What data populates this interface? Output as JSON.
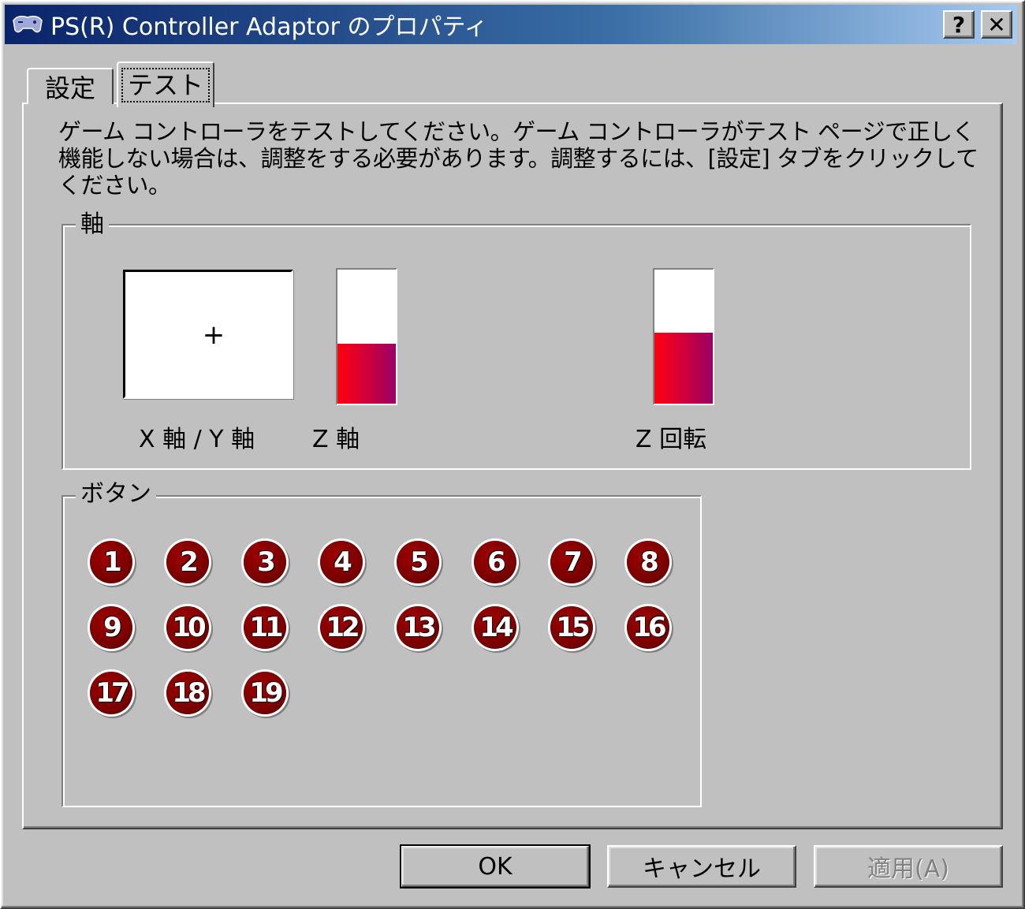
{
  "window": {
    "title": "PS(R) Controller Adaptor のプロパティ",
    "help_label": "?",
    "close_label": "✕"
  },
  "tabs": [
    {
      "label": "設定",
      "selected": false
    },
    {
      "label": "テスト",
      "selected": true
    }
  ],
  "description": "ゲーム コントローラをテストしてください。ゲーム コントローラがテスト ページで正しく機能しない場合は、調整をする必要があります。調整するには、[設定] タブをクリックしてください。",
  "axes": {
    "legend": "軸",
    "crosshair": "+",
    "xy_label": "X 軸 / Y 軸",
    "z_label": "Z 軸",
    "z_level": 0.45,
    "z_rotation_label": "Z 回転",
    "z_rotation_level": 0.53
  },
  "buttons_group": {
    "legend": "ボタン",
    "items": [
      "1",
      "2",
      "3",
      "4",
      "5",
      "6",
      "7",
      "8",
      "9",
      "10",
      "11",
      "12",
      "13",
      "14",
      "15",
      "16",
      "17",
      "18",
      "19"
    ]
  },
  "actions": {
    "ok_label": "OK",
    "cancel_label": "キャンセル",
    "apply_label": "適用(A)",
    "apply_enabled": false
  },
  "colors": {
    "active_title_start": "#0a246a",
    "active_title_end": "#a6caf0",
    "axis_fill": "#e8002a",
    "button_indicator": "#7a0000"
  }
}
